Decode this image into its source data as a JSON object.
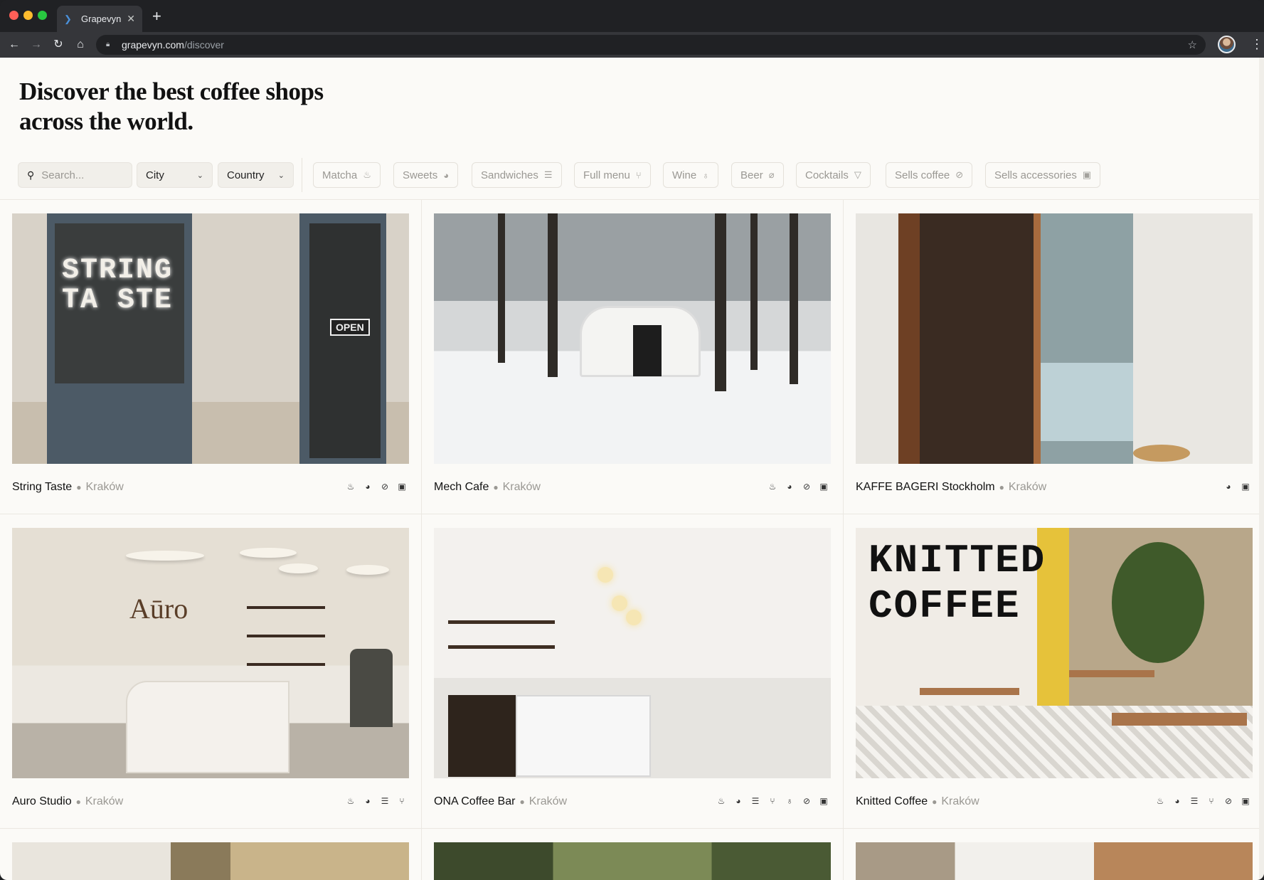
{
  "browser": {
    "tab_title": "Grapevyn",
    "url_host": "grapevyn.com",
    "url_path": "/discover"
  },
  "page": {
    "title_line1": "Discover the best coffee shops",
    "title_line2": "across the world."
  },
  "filters": {
    "search_placeholder": "Search...",
    "city_label": "City",
    "country_label": "Country",
    "chips": [
      {
        "label": "Matcha",
        "icon": "matcha-bowl-icon",
        "glyph": "♨"
      },
      {
        "label": "Sweets",
        "icon": "cookie-icon",
        "glyph": "◕"
      },
      {
        "label": "Sandwiches",
        "icon": "sandwich-icon",
        "glyph": "☰"
      },
      {
        "label": "Full menu",
        "icon": "fork-knife-icon",
        "glyph": "⑂"
      },
      {
        "label": "Wine",
        "icon": "wine-glass-icon",
        "glyph": "♁"
      },
      {
        "label": "Beer",
        "icon": "bottle-icon",
        "glyph": "⌀"
      },
      {
        "label": "Cocktails",
        "icon": "cocktail-icon",
        "glyph": "▽"
      },
      {
        "label": "Sells coffee",
        "icon": "coffee-bean-icon",
        "glyph": "⊘"
      },
      {
        "label": "Sells accessories",
        "icon": "bag-icon",
        "glyph": "▣"
      }
    ]
  },
  "cards": [
    {
      "name": "String Taste",
      "city": "Kraków",
      "features": [
        "matcha-bowl-icon",
        "cookie-icon",
        "coffee-bean-icon",
        "bag-icon"
      ]
    },
    {
      "name": "Mech Cafe",
      "city": "Kraków",
      "features": [
        "matcha-bowl-icon",
        "cookie-icon",
        "coffee-bean-icon",
        "bag-icon"
      ]
    },
    {
      "name": "KAFFE BAGERI Stockholm",
      "city": "Kraków",
      "features": [
        "cookie-icon",
        "bag-icon"
      ]
    },
    {
      "name": "Auro Studio",
      "city": "Kraków",
      "features": [
        "matcha-bowl-icon",
        "cookie-icon",
        "sandwich-icon",
        "fork-knife-icon"
      ]
    },
    {
      "name": "ONA Coffee Bar",
      "city": "Kraków",
      "features": [
        "matcha-bowl-icon",
        "cookie-icon",
        "sandwich-icon",
        "fork-knife-icon",
        "wine-glass-icon",
        "coffee-bean-icon",
        "bag-icon"
      ]
    },
    {
      "name": "Knitted Coffee",
      "city": "Kraków",
      "features": [
        "matcha-bowl-icon",
        "cookie-icon",
        "sandwich-icon",
        "fork-knife-icon",
        "coffee-bean-icon",
        "bag-icon"
      ]
    }
  ],
  "image_text": {
    "string_neon": "STRING\nTA STE",
    "string_open": "OPEN",
    "auro_logo": "Aūro",
    "knitted_word": "KNITTED\nCOFFEE"
  },
  "icon_glyphs": {
    "matcha-bowl-icon": "♨",
    "cookie-icon": "◕",
    "sandwich-icon": "☰",
    "fork-knife-icon": "⑂",
    "wine-glass-icon": "♁",
    "coffee-bean-icon": "⊘",
    "bag-icon": "▣"
  },
  "colors": {
    "page_bg": "#fbfaf7",
    "chrome_dark": "#202124",
    "muted_text": "#9a9893"
  }
}
